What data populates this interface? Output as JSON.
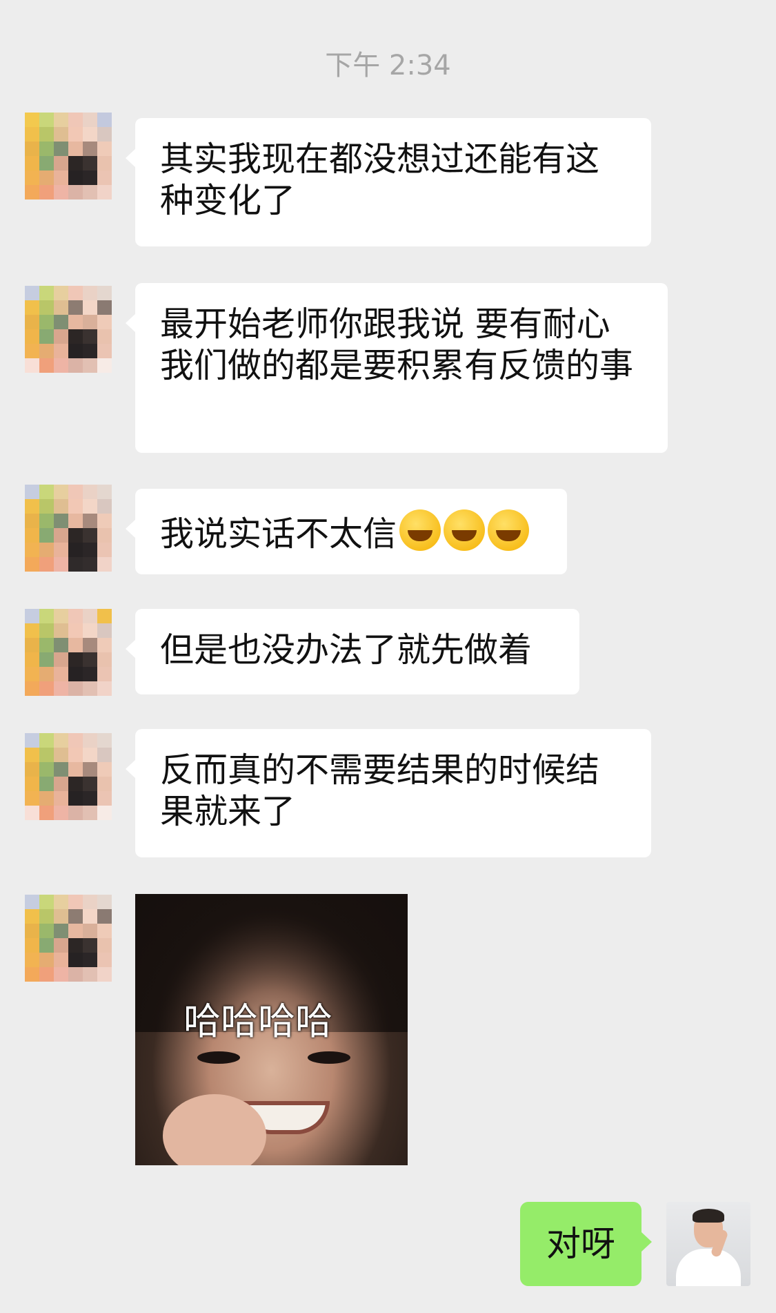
{
  "timestamp": "下午 2:34",
  "messages": [
    {
      "text": "其实我现在都没想过还能有这种变化了"
    },
    {
      "text": "最开始老师你跟我说 要有耐心 我们做的都是要积累有反馈的事"
    },
    {
      "text": "我说实话不太信",
      "emoji": "crying-laughing-face-icon"
    },
    {
      "text": "但是也没办法了就先做着"
    },
    {
      "text": "反而真的不需要结果的时候结果就来了"
    }
  ],
  "sticker": {
    "caption": "哈哈哈哈"
  },
  "reply": {
    "text": "对呀"
  },
  "colors": {
    "background": "#ededed",
    "incoming_bubble": "#ffffff",
    "outgoing_bubble": "#95ec69"
  }
}
